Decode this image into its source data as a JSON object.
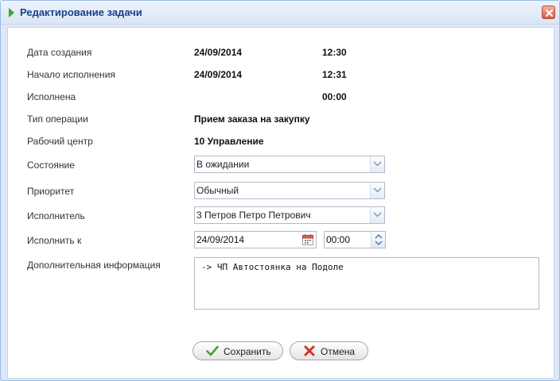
{
  "window": {
    "title": "Редактирование задачи"
  },
  "form": {
    "created_label": "Дата создания",
    "created_date": "24/09/2014",
    "created_time": "12:30",
    "start_label": "Начало исполнения",
    "start_date": "24/09/2014",
    "start_time": "12:31",
    "done_label": "Исполнена",
    "done_time": "00:00",
    "operation_label": "Тип операции",
    "operation_value": "Прием заказа на закупку",
    "workcenter_label": "Рабочий центр",
    "workcenter_value": "10 Управление",
    "state_label": "Состояние",
    "state_value": "В ожидании",
    "priority_label": "Приоритет",
    "priority_value": "Обычный",
    "executor_label": "Исполнитель",
    "executor_value": "3 Петров Петро Петрович",
    "due_label": "Исполнить к",
    "due_date": "24/09/2014",
    "due_time": "00:00",
    "info_label": "Дополнительная информация",
    "info_value": "-> ЧП Автостоянка на Подоле"
  },
  "buttons": {
    "save_label": "Сохранить",
    "cancel_label": "Отмена"
  },
  "colors": {
    "title": "#15428b",
    "accent_green": "#3fa52a",
    "cancel_red": "#d2332a"
  }
}
